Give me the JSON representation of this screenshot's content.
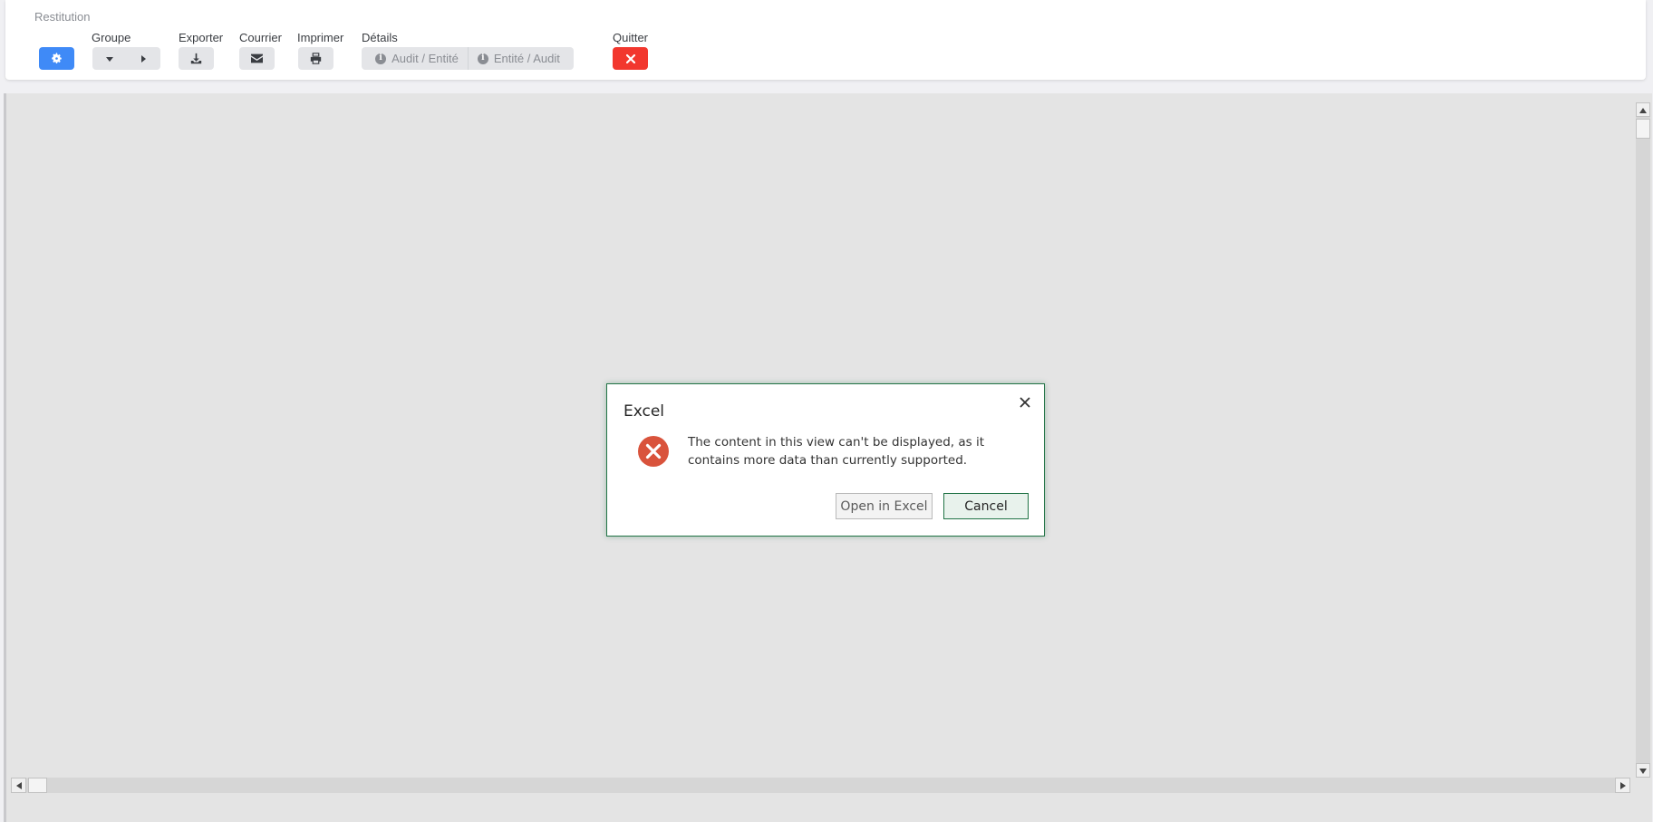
{
  "toolbar": {
    "section_title": "Restitution",
    "groups": {
      "groupe": "Groupe",
      "exporter": "Exporter",
      "courrier": "Courrier",
      "imprimer": "Imprimer",
      "details": "Détails",
      "quitter": "Quitter"
    },
    "details_buttons": [
      "Audit / Entité",
      "Entité / Audit"
    ],
    "icons": {
      "settings": "gear-icon",
      "collapse": "caret-down-icon",
      "expand": "caret-right-icon",
      "export": "download-icon",
      "mail": "envelope-icon",
      "print": "printer-icon",
      "info": "info-icon",
      "quit": "close-icon"
    },
    "colors": {
      "primary": "#3f8af7",
      "danger": "#f2372e",
      "neutral": "#e4e5e8"
    }
  },
  "dialog": {
    "title": "Excel",
    "message": "The content in this view can't be displayed, as it contains more data than currently supported.",
    "buttons": {
      "open": "Open in Excel",
      "cancel": "Cancel"
    },
    "icon": "error-circle-icon",
    "colors": {
      "accent": "#217346",
      "error": "#d9533c"
    }
  }
}
